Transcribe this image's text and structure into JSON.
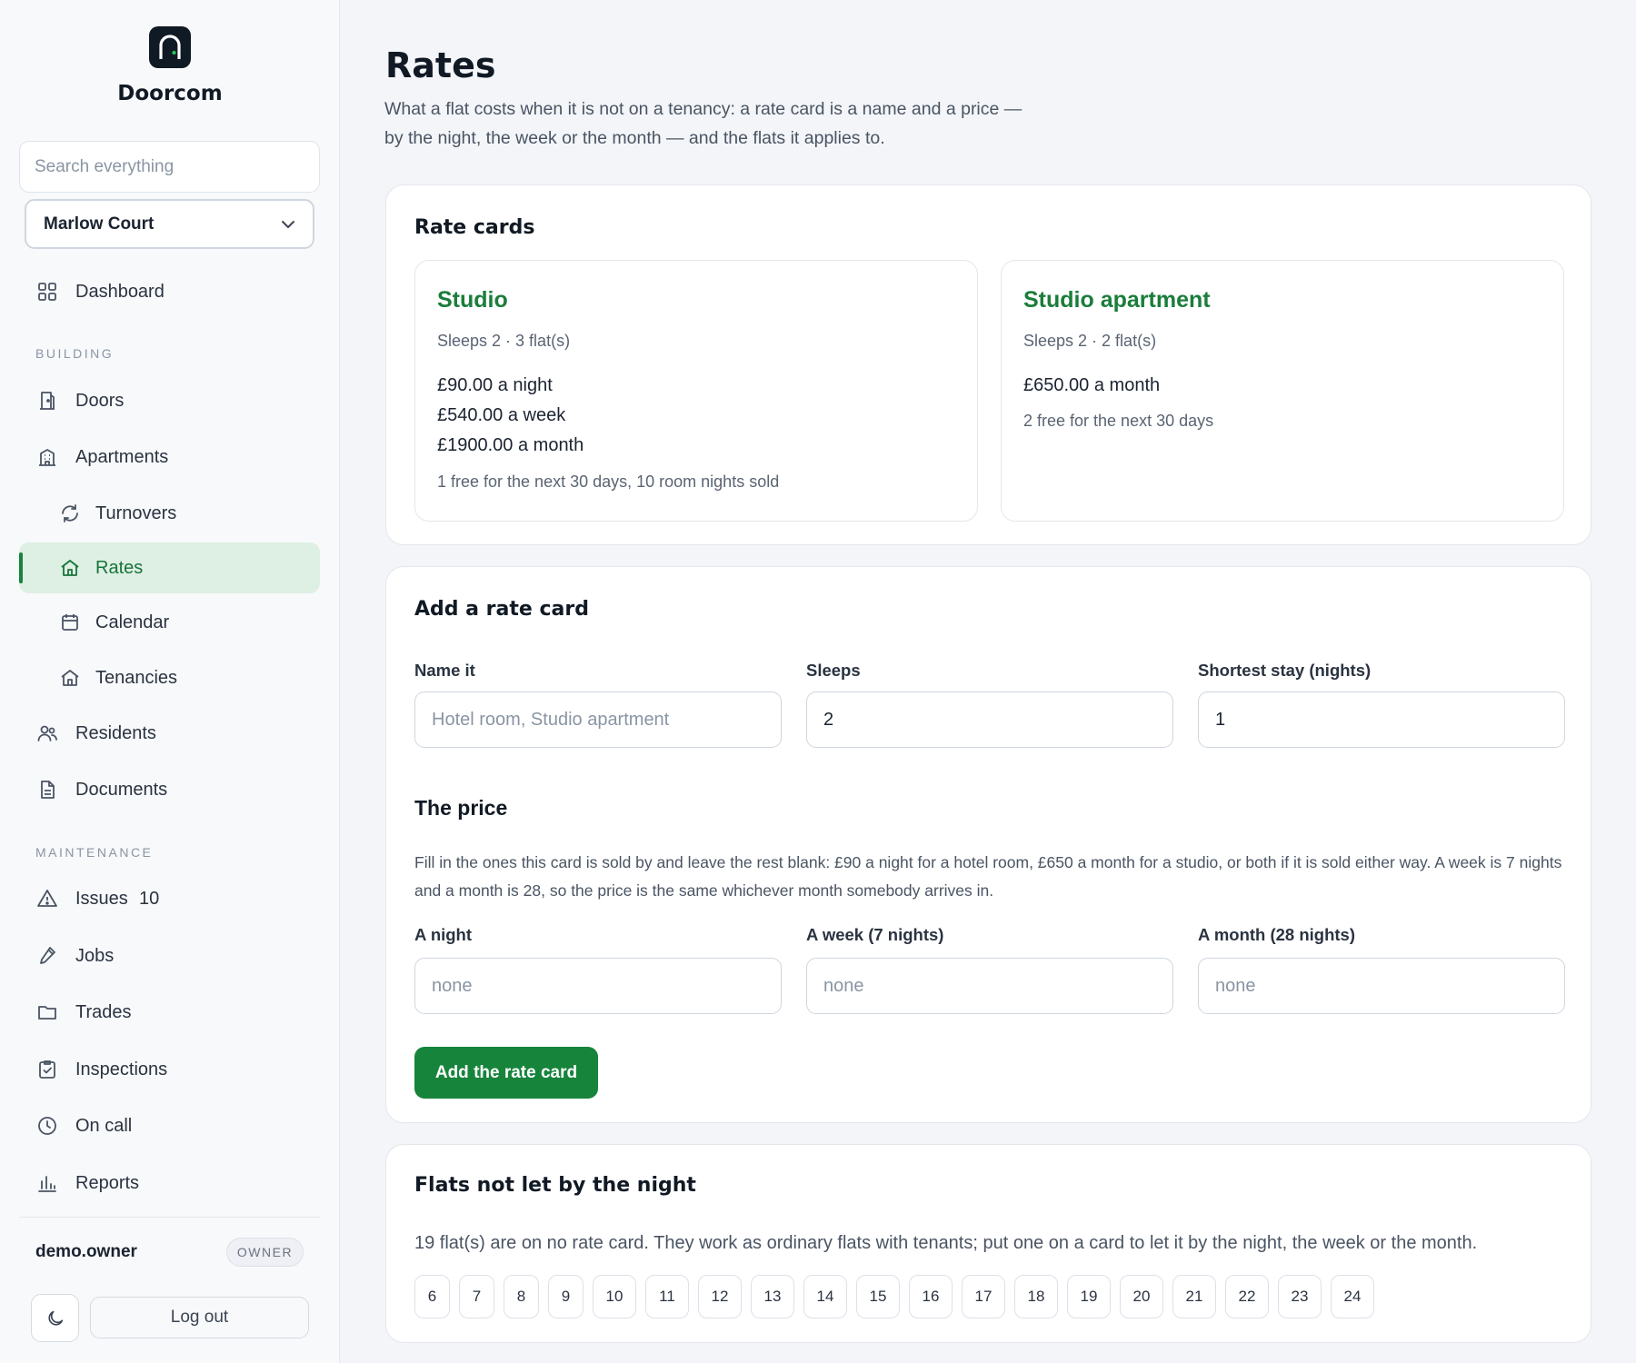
{
  "brand": {
    "name": "Doorcom",
    "logo": "door-logo-icon"
  },
  "search": {
    "placeholder": "Search everything"
  },
  "building_select": {
    "value": "Marlow Court",
    "icon": "chevron-down-icon"
  },
  "nav": {
    "dashboard": {
      "label": "Dashboard",
      "icon": "grid-icon"
    },
    "building_section": "BUILDING",
    "doors": {
      "label": "Doors",
      "icon": "door-icon"
    },
    "apartments": {
      "label": "Apartments",
      "icon": "building-icon"
    },
    "turnovers": {
      "label": "Turnovers",
      "icon": "refresh-icon"
    },
    "rates": {
      "label": "Rates",
      "icon": "home-icon"
    },
    "calendar": {
      "label": "Calendar",
      "icon": "calendar-icon"
    },
    "tenancies": {
      "label": "Tenancies",
      "icon": "home-icon"
    },
    "residents": {
      "label": "Residents",
      "icon": "people-icon"
    },
    "documents": {
      "label": "Documents",
      "icon": "document-icon"
    },
    "maintenance_section": "MAINTENANCE",
    "issues": {
      "label": "Issues",
      "count": "10",
      "icon": "warning-icon"
    },
    "jobs": {
      "label": "Jobs",
      "icon": "wrench-icon"
    },
    "trades": {
      "label": "Trades",
      "icon": "folder-icon"
    },
    "inspections": {
      "label": "Inspections",
      "icon": "clipboard-check-icon"
    },
    "on_call": {
      "label": "On call",
      "icon": "clock-icon"
    },
    "reports": {
      "label": "Reports",
      "icon": "bar-chart-icon"
    }
  },
  "user": {
    "name": "demo.owner",
    "role": "OWNER"
  },
  "footer": {
    "theme_icon": "moon-icon",
    "logout": "Log out"
  },
  "page": {
    "title": "Rates",
    "description": "What a flat costs when it is not on a tenancy: a rate card is a name and a price — by the night, the week or the month — and the flats it applies to."
  },
  "rate_cards": {
    "title": "Rate cards",
    "cards": [
      {
        "name": "Studio",
        "meta": "Sleeps 2 · 3 flat(s)",
        "prices": [
          "£90.00 a night",
          "£540.00 a week",
          "£1900.00 a month"
        ],
        "availability": "1 free for the next 30 days, 10 room nights sold"
      },
      {
        "name": "Studio apartment",
        "meta": "Sleeps 2 · 2 flat(s)",
        "prices": [
          "£650.00 a month"
        ],
        "availability": "2 free for the next 30 days"
      }
    ]
  },
  "add_form": {
    "title": "Add a rate card",
    "name_label": "Name it",
    "name_placeholder": "Hotel room, Studio apartment",
    "sleeps_label": "Sleeps",
    "sleeps_value": "2",
    "shortest_label": "Shortest stay (nights)",
    "shortest_value": "1",
    "price_title": "The price",
    "price_help": "Fill in the ones this card is sold by and leave the rest blank: £90 a night for a hotel room, £650 a month for a studio, or both if it is sold either way. A week is 7 nights and a month is 28, so the price is the same whichever month somebody arrives in.",
    "night_label": "A night",
    "week_label": "A week (7 nights)",
    "month_label": "A month (28 nights)",
    "price_placeholder": "none",
    "submit": "Add the rate card"
  },
  "unrated": {
    "title": "Flats not let by the night",
    "note": "19 flat(s) are on no rate card. They work as ordinary flats with tenants; put one on a card to let it by the night, the week or the month.",
    "flats": [
      "6",
      "7",
      "8",
      "9",
      "10",
      "11",
      "12",
      "13",
      "14",
      "15",
      "16",
      "17",
      "18",
      "19",
      "20",
      "21",
      "22",
      "23",
      "24"
    ]
  },
  "colors": {
    "accent": "#17843c",
    "accent_text": "#1b7d3b",
    "active_bg": "#deefe3",
    "page_bg": "#f3f5f8"
  }
}
